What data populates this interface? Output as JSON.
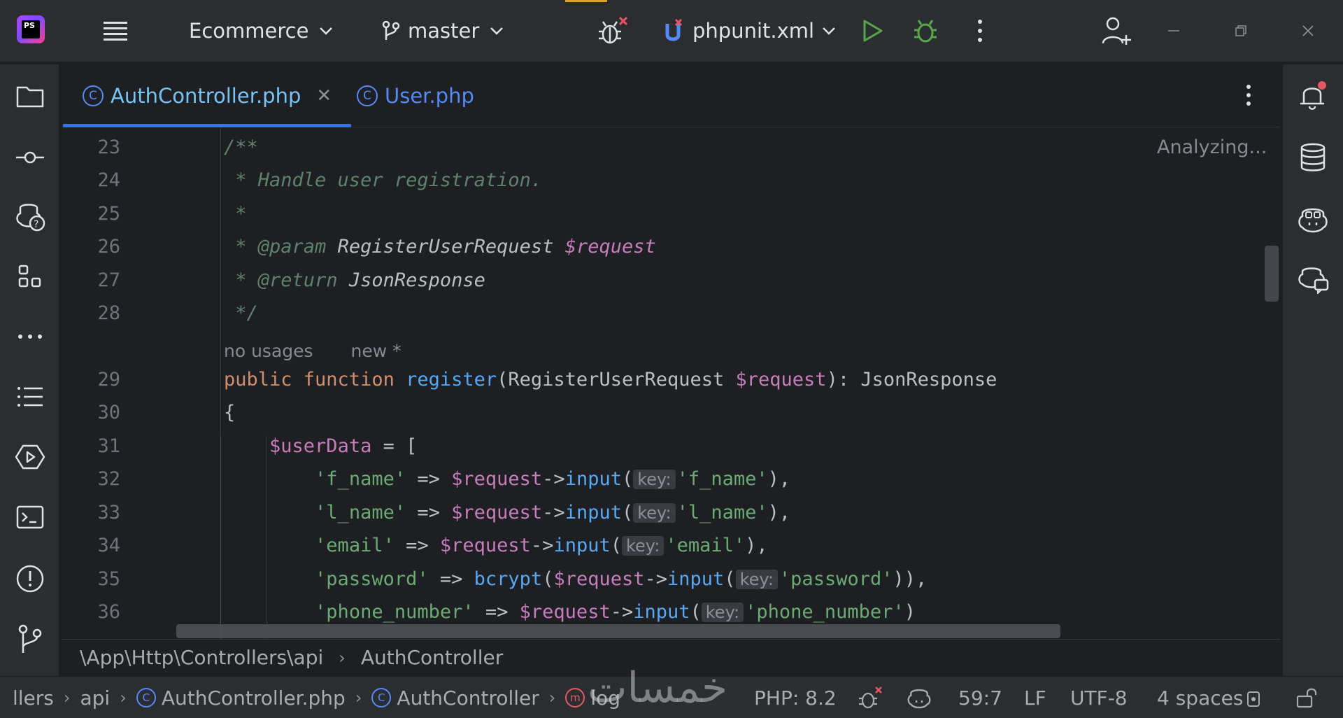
{
  "titlebar": {
    "app_logo_text": "PS",
    "project": "Ecommerce",
    "branch": "master",
    "run_config": "phpunit.xml",
    "window_controls": [
      "minimize-icon",
      "restore-icon",
      "close-icon"
    ]
  },
  "left_toolbar": [
    "folder-icon",
    "commit-icon",
    "ai-assistant-icon",
    "structure-icon",
    "more-icon",
    "list-icon",
    "services-icon",
    "terminal-icon",
    "problems-icon",
    "git-icon"
  ],
  "right_toolbar": [
    "notifications-icon",
    "database-icon",
    "copilot-icon",
    "copilot-chat-icon"
  ],
  "tabs": [
    {
      "label": "AuthController.php",
      "active": true,
      "closable": true
    },
    {
      "label": "User.php",
      "active": false,
      "closable": false
    }
  ],
  "editor": {
    "status": "Analyzing...",
    "inlay": {
      "usages": "no usages",
      "new": "new *"
    },
    "hint_key": "key:",
    "lines": [
      {
        "num": "23",
        "parts": [
          [
            "cm",
            "/**"
          ]
        ]
      },
      {
        "num": "24",
        "parts": [
          [
            "cm",
            " * Handle user registration."
          ]
        ]
      },
      {
        "num": "25",
        "parts": [
          [
            "cm",
            " *"
          ]
        ]
      },
      {
        "num": "26",
        "parts": [
          [
            "cm",
            " * "
          ],
          [
            "cm-tag",
            "@param"
          ],
          [
            "cm-type",
            " RegisterUserRequest "
          ],
          [
            "cm-var",
            "$request"
          ]
        ]
      },
      {
        "num": "27",
        "parts": [
          [
            "cm",
            " * "
          ],
          [
            "cm-tag",
            "@return"
          ],
          [
            "cm-type",
            " JsonResponse"
          ]
        ]
      },
      {
        "num": "28",
        "parts": [
          [
            "cm",
            " */"
          ]
        ]
      },
      {
        "num": "29",
        "parts": [
          [
            "kw",
            "public function "
          ],
          [
            "fn",
            "register"
          ],
          [
            "pl",
            "(RegisterUserRequest "
          ],
          [
            "var",
            "$request"
          ],
          [
            "pl",
            "): JsonResponse"
          ]
        ]
      },
      {
        "num": "30",
        "parts": [
          [
            "pl",
            "{"
          ]
        ]
      },
      {
        "num": "31",
        "parts": [
          [
            "pl",
            "    "
          ],
          [
            "var",
            "$userData"
          ],
          [
            "pl",
            " = ["
          ]
        ]
      },
      {
        "num": "32",
        "parts": [
          [
            "pl",
            "        "
          ],
          [
            "str",
            "'f_name'"
          ],
          [
            "pl",
            " => "
          ],
          [
            "var",
            "$request"
          ],
          [
            "pl",
            "->"
          ],
          [
            "fn",
            "input"
          ],
          [
            "pl",
            "("
          ],
          [
            "hint",
            "key:"
          ],
          [
            "str",
            "'f_name'"
          ],
          [
            "pl",
            "),"
          ]
        ]
      },
      {
        "num": "33",
        "parts": [
          [
            "pl",
            "        "
          ],
          [
            "str",
            "'l_name'"
          ],
          [
            "pl",
            " => "
          ],
          [
            "var",
            "$request"
          ],
          [
            "pl",
            "->"
          ],
          [
            "fn",
            "input"
          ],
          [
            "pl",
            "("
          ],
          [
            "hint",
            "key:"
          ],
          [
            "str",
            "'l_name'"
          ],
          [
            "pl",
            "),"
          ]
        ]
      },
      {
        "num": "34",
        "parts": [
          [
            "pl",
            "        "
          ],
          [
            "str",
            "'email'"
          ],
          [
            "pl",
            " => "
          ],
          [
            "var",
            "$request"
          ],
          [
            "pl",
            "->"
          ],
          [
            "fn",
            "input"
          ],
          [
            "pl",
            "("
          ],
          [
            "hint",
            "key:"
          ],
          [
            "str",
            "'email'"
          ],
          [
            "pl",
            "),"
          ]
        ]
      },
      {
        "num": "35",
        "parts": [
          [
            "pl",
            "        "
          ],
          [
            "str",
            "'password'"
          ],
          [
            "pl",
            " => "
          ],
          [
            "fn",
            "bcrypt"
          ],
          [
            "pl",
            "("
          ],
          [
            "var",
            "$request"
          ],
          [
            "pl",
            "->"
          ],
          [
            "fn",
            "input"
          ],
          [
            "pl",
            "("
          ],
          [
            "hint",
            "key:"
          ],
          [
            "str",
            "'password'"
          ],
          [
            "pl",
            ")),"
          ]
        ]
      },
      {
        "num": "36",
        "parts": [
          [
            "pl",
            "        "
          ],
          [
            "str",
            "'phone_number'"
          ],
          [
            "pl",
            " => "
          ],
          [
            "var",
            "$request"
          ],
          [
            "pl",
            "->"
          ],
          [
            "fn",
            "input"
          ],
          [
            "pl",
            "("
          ],
          [
            "hint",
            "key:"
          ],
          [
            "str",
            "'phone_number'"
          ],
          [
            "pl",
            ")"
          ]
        ]
      }
    ]
  },
  "breadcrumb": {
    "namespace": "\\App\\Http\\Controllers\\api",
    "class": "AuthController"
  },
  "statusbar": {
    "path": [
      "llers",
      "api",
      "AuthController.php",
      "AuthController",
      "log"
    ],
    "php": "PHP: 8.2",
    "position": "59:7",
    "line_ending": "LF",
    "encoding": "UTF-8",
    "indent": "4 spaces"
  },
  "watermark": "خمسات"
}
